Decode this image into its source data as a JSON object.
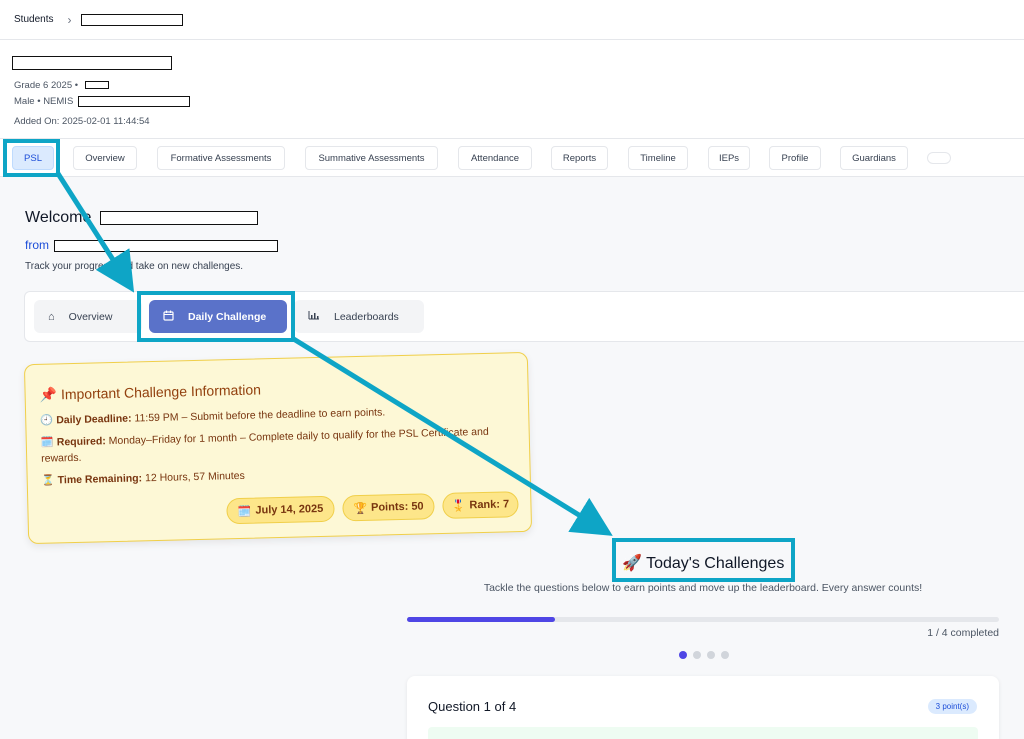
{
  "breadcrumb": {
    "root": "Students"
  },
  "student": {
    "grade_line": "Grade 6 2025 •",
    "gender_line": "Male • NEMIS",
    "added_on": "Added On: 2025-02-01 11:44:54"
  },
  "tabs": [
    {
      "label": "PSL"
    },
    {
      "label": "Overview"
    },
    {
      "label": "Formative Assessments"
    },
    {
      "label": "Summative Assessments"
    },
    {
      "label": "Attendance"
    },
    {
      "label": "Reports"
    },
    {
      "label": "Timeline"
    },
    {
      "label": "IEPs"
    },
    {
      "label": "Profile"
    },
    {
      "label": "Guardians"
    }
  ],
  "welcome": {
    "title": "Welcome",
    "from": "from",
    "subtitle": "Track your progress and take on new challenges."
  },
  "subtabs": [
    {
      "label": "Overview",
      "icon": "home-icon"
    },
    {
      "label": "Daily Challenge",
      "icon": "calendar-icon"
    },
    {
      "label": "Leaderboards",
      "icon": "bar-chart-icon"
    }
  ],
  "info": {
    "title": "Important Challenge Information",
    "deadline_label": "Daily Deadline:",
    "deadline_text": "11:59 PM – Submit before the deadline to earn points.",
    "required_label": "Required:",
    "required_text": "Monday–Friday for 1 month – Complete daily to qualify for the PSL Certificate and rewards.",
    "remaining_label": "Time Remaining:",
    "remaining_text": "12 Hours, 57 Minutes",
    "date_pill": "July 14, 2025",
    "points_pill": "Points: 50",
    "rank_pill": "Rank: 7"
  },
  "challenges": {
    "title": "Today's Challenges",
    "subtitle": "Tackle the questions below to earn points and move up the leaderboard. Every answer counts!",
    "progress_fraction": 0.25,
    "completed_text": "1 / 4 completed",
    "question_title": "Question 1 of 4",
    "points_badge": "3 point(s)"
  },
  "colors": {
    "accent": "#0ea5c6",
    "active_subtab": "#5a72c9",
    "progress": "#4f46e5"
  }
}
